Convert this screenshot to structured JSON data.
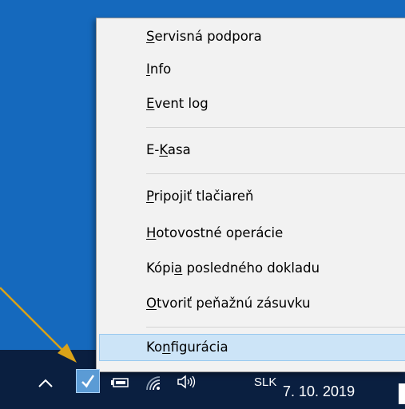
{
  "menu": {
    "items": [
      {
        "pre": "",
        "key": "S",
        "post": "ervisná podpora"
      },
      {
        "pre": "",
        "key": "I",
        "post": "nfo"
      },
      {
        "pre": "",
        "key": "E",
        "post": "vent log"
      },
      {
        "pre": "E-",
        "key": "K",
        "post": "asa"
      },
      {
        "pre": "",
        "key": "P",
        "post": "ripojiť tlačiareň"
      },
      {
        "pre": "",
        "key": "H",
        "post": "otovostné operácie"
      },
      {
        "pre": "Kópi",
        "key": "a",
        "post": " posledného dokladu"
      },
      {
        "pre": "",
        "key": "O",
        "post": "tvoriť peňažnú zásuvku"
      },
      {
        "pre": "Ko",
        "key": "n",
        "post": "figurácia"
      }
    ],
    "highlighted_index": 8
  },
  "taskbar": {
    "language": "SLK",
    "date": "7. 10. 2019"
  },
  "colors": {
    "desktop": "#1569bd",
    "taskbar": "#0a1f40",
    "menu_bg": "#f2f2f2",
    "highlight": "#cce4f7",
    "arrow": "#d9a218"
  },
  "icons": [
    "chevron-up-icon",
    "ekasa-app-icon",
    "battery-icon",
    "wifi-icon",
    "speaker-icon"
  ]
}
